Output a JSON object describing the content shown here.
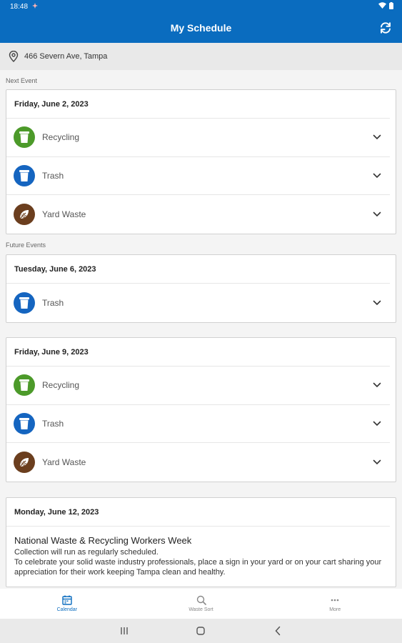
{
  "status_bar": {
    "time": "18:48"
  },
  "app_bar": {
    "title": "My Schedule"
  },
  "address": {
    "text": "466 Severn Ave, Tampa"
  },
  "sections": {
    "next_label": "Next Event",
    "future_label": "Future Events"
  },
  "events": [
    {
      "date": "Friday, June 2, 2023",
      "items": [
        {
          "label": "Recycling",
          "icon": "recycling-bin-icon",
          "color": "#4c9a2a"
        },
        {
          "label": "Trash",
          "icon": "trash-bin-icon",
          "color": "#1565c0"
        },
        {
          "label": "Yard Waste",
          "icon": "leaf-icon",
          "color": "#6b3e1e"
        }
      ]
    },
    {
      "date": "Tuesday, June 6, 2023",
      "items": [
        {
          "label": "Trash",
          "icon": "trash-bin-icon",
          "color": "#1565c0"
        }
      ]
    },
    {
      "date": "Friday, June 9, 2023",
      "items": [
        {
          "label": "Recycling",
          "icon": "recycling-bin-icon",
          "color": "#4c9a2a"
        },
        {
          "label": "Trash",
          "icon": "trash-bin-icon",
          "color": "#1565c0"
        },
        {
          "label": "Yard Waste",
          "icon": "leaf-icon",
          "color": "#6b3e1e"
        }
      ]
    }
  ],
  "notice": {
    "date": "Monday, June 12, 2023",
    "title": "National Waste & Recycling Workers Week",
    "line1": "Collection will run as regularly scheduled.",
    "line2": "To celebrate your solid waste industry professionals, place a sign in your yard or on your cart sharing your appreciation for their work keeping Tampa clean and healthy."
  },
  "bottom_nav": {
    "calendar": "Calendar",
    "waste_sort": "Waste Sort",
    "more": "More"
  },
  "colors": {
    "primary": "#0a6cbf",
    "recycling": "#4c9a2a",
    "trash": "#1565c0",
    "yard": "#6b3e1e"
  }
}
